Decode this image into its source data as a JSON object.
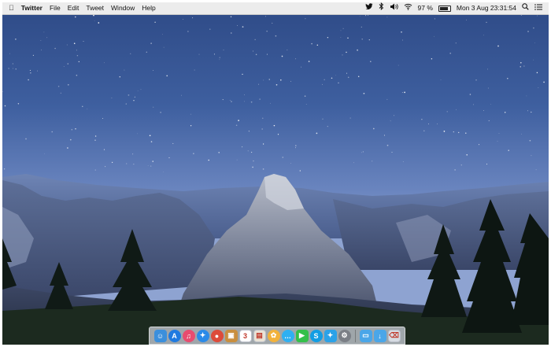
{
  "menubar": {
    "apple_icon": "apple-icon",
    "app_name": "Twitter",
    "menus": [
      "File",
      "Edit",
      "Tweet",
      "Window",
      "Help"
    ],
    "status": {
      "twitter_icon": "twitter-bird-icon",
      "bluetooth_icon": "bluetooth-icon",
      "volume_icon": "volume-icon",
      "wifi_icon": "wifi-icon",
      "battery_percent": "97 %",
      "battery_icon": "battery-icon",
      "datetime": "Mon 3 Aug  23:31:54",
      "spotlight_icon": "search-icon",
      "notification_icon": "list-icon"
    }
  },
  "desktop": {
    "wallpaper": "night sky over mountain valley with granite dome and pine trees"
  },
  "dock": {
    "apps": [
      {
        "name": "finder-icon",
        "glyph": "☺",
        "color": "#3b8fdc"
      },
      {
        "name": "app-store-icon",
        "glyph": "A",
        "color": "#1f7ae0"
      },
      {
        "name": "itunes-icon",
        "glyph": "♫",
        "color": "#e84c6f"
      },
      {
        "name": "safari-icon",
        "glyph": "✦",
        "color": "#2a8ae8"
      },
      {
        "name": "chrome-icon",
        "glyph": "●",
        "color": "#dd4b3a"
      },
      {
        "name": "package-icon",
        "glyph": "▣",
        "color": "#c98f3f"
      },
      {
        "name": "calendar-icon",
        "glyph": "3",
        "color": "#ffffff"
      },
      {
        "name": "preview-icon",
        "glyph": "▤",
        "color": "#e9e3d6"
      },
      {
        "name": "photos-icon",
        "glyph": "✿",
        "color": "#f2b23c"
      },
      {
        "name": "messages-icon",
        "glyph": "…",
        "color": "#2eb0f2"
      },
      {
        "name": "facetime-icon",
        "glyph": "▶",
        "color": "#34c04a"
      },
      {
        "name": "skype-icon",
        "glyph": "S",
        "color": "#129de3"
      },
      {
        "name": "twitter-icon",
        "glyph": "✦",
        "color": "#2ba2e8"
      },
      {
        "name": "system-preferences-icon",
        "glyph": "⚙",
        "color": "#7b7f86"
      }
    ],
    "folders": [
      {
        "name": "applications-folder-icon",
        "glyph": "▭",
        "color": "#4aa6e8"
      },
      {
        "name": "downloads-folder-icon",
        "glyph": "↓",
        "color": "#4aa6e8"
      },
      {
        "name": "trash-icon",
        "glyph": "⌫",
        "color": "#d7dce3"
      }
    ]
  }
}
